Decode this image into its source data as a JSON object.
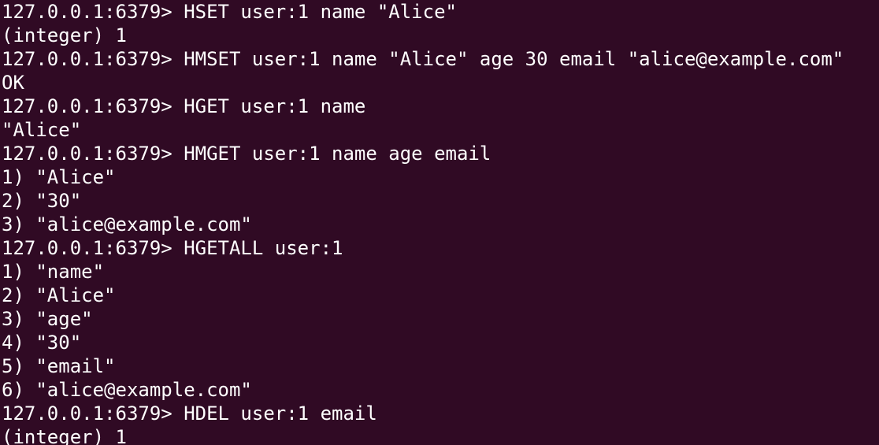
{
  "terminal": {
    "prompt": "127.0.0.1:6379> ",
    "lines": [
      {
        "kind": "command",
        "text": "HSET user:1 name \"Alice\""
      },
      {
        "kind": "output",
        "text": "(integer) 1"
      },
      {
        "kind": "command",
        "text": "HMSET user:1 name \"Alice\" age 30 email \"alice@example.com\""
      },
      {
        "kind": "output",
        "text": "OK"
      },
      {
        "kind": "command",
        "text": "HGET user:1 name"
      },
      {
        "kind": "output",
        "text": "\"Alice\""
      },
      {
        "kind": "command",
        "text": "HMGET user:1 name age email"
      },
      {
        "kind": "output",
        "text": "1) \"Alice\""
      },
      {
        "kind": "output",
        "text": "2) \"30\""
      },
      {
        "kind": "output",
        "text": "3) \"alice@example.com\""
      },
      {
        "kind": "command",
        "text": "HGETALL user:1"
      },
      {
        "kind": "output",
        "text": "1) \"name\""
      },
      {
        "kind": "output",
        "text": "2) \"Alice\""
      },
      {
        "kind": "output",
        "text": "3) \"age\""
      },
      {
        "kind": "output",
        "text": "4) \"30\""
      },
      {
        "kind": "output",
        "text": "5) \"email\""
      },
      {
        "kind": "output",
        "text": "6) \"alice@example.com\""
      },
      {
        "kind": "command",
        "text": "HDEL user:1 email"
      },
      {
        "kind": "output",
        "text": "(integer) 1"
      }
    ]
  },
  "colors": {
    "background": "#300a24",
    "foreground": "#ffffff"
  }
}
